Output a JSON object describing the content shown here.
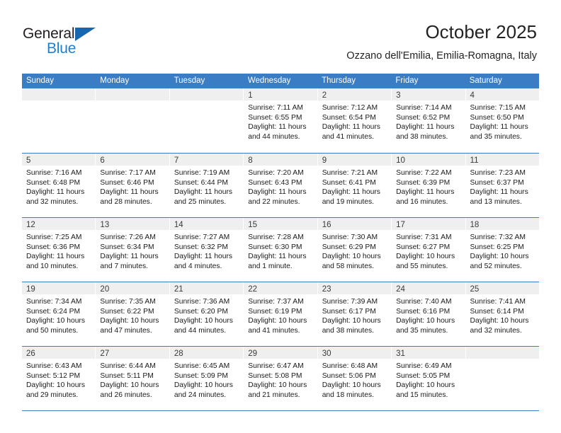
{
  "brand": {
    "name_top": "General",
    "name_bottom": "Blue",
    "color_dark": "#231f20",
    "color_blue": "#1f7fd1"
  },
  "header": {
    "title": "October 2025",
    "subtitle": "Ozzano dell'Emilia, Emilia-Romagna, Italy"
  },
  "theme": {
    "header_bg": "#3b7dc4",
    "daynum_bg": "#efefef",
    "text": "#1a1a1a"
  },
  "calendar": {
    "weekdays": [
      "Sunday",
      "Monday",
      "Tuesday",
      "Wednesday",
      "Thursday",
      "Friday",
      "Saturday"
    ],
    "weeks": [
      [
        {
          "day": "",
          "lines": []
        },
        {
          "day": "",
          "lines": []
        },
        {
          "day": "",
          "lines": []
        },
        {
          "day": "1",
          "lines": [
            "Sunrise: 7:11 AM",
            "Sunset: 6:55 PM",
            "Daylight: 11 hours",
            "and 44 minutes."
          ]
        },
        {
          "day": "2",
          "lines": [
            "Sunrise: 7:12 AM",
            "Sunset: 6:54 PM",
            "Daylight: 11 hours",
            "and 41 minutes."
          ]
        },
        {
          "day": "3",
          "lines": [
            "Sunrise: 7:14 AM",
            "Sunset: 6:52 PM",
            "Daylight: 11 hours",
            "and 38 minutes."
          ]
        },
        {
          "day": "4",
          "lines": [
            "Sunrise: 7:15 AM",
            "Sunset: 6:50 PM",
            "Daylight: 11 hours",
            "and 35 minutes."
          ]
        }
      ],
      [
        {
          "day": "5",
          "lines": [
            "Sunrise: 7:16 AM",
            "Sunset: 6:48 PM",
            "Daylight: 11 hours",
            "and 32 minutes."
          ]
        },
        {
          "day": "6",
          "lines": [
            "Sunrise: 7:17 AM",
            "Sunset: 6:46 PM",
            "Daylight: 11 hours",
            "and 28 minutes."
          ]
        },
        {
          "day": "7",
          "lines": [
            "Sunrise: 7:19 AM",
            "Sunset: 6:44 PM",
            "Daylight: 11 hours",
            "and 25 minutes."
          ]
        },
        {
          "day": "8",
          "lines": [
            "Sunrise: 7:20 AM",
            "Sunset: 6:43 PM",
            "Daylight: 11 hours",
            "and 22 minutes."
          ]
        },
        {
          "day": "9",
          "lines": [
            "Sunrise: 7:21 AM",
            "Sunset: 6:41 PM",
            "Daylight: 11 hours",
            "and 19 minutes."
          ]
        },
        {
          "day": "10",
          "lines": [
            "Sunrise: 7:22 AM",
            "Sunset: 6:39 PM",
            "Daylight: 11 hours",
            "and 16 minutes."
          ]
        },
        {
          "day": "11",
          "lines": [
            "Sunrise: 7:23 AM",
            "Sunset: 6:37 PM",
            "Daylight: 11 hours",
            "and 13 minutes."
          ]
        }
      ],
      [
        {
          "day": "12",
          "lines": [
            "Sunrise: 7:25 AM",
            "Sunset: 6:36 PM",
            "Daylight: 11 hours",
            "and 10 minutes."
          ]
        },
        {
          "day": "13",
          "lines": [
            "Sunrise: 7:26 AM",
            "Sunset: 6:34 PM",
            "Daylight: 11 hours",
            "and 7 minutes."
          ]
        },
        {
          "day": "14",
          "lines": [
            "Sunrise: 7:27 AM",
            "Sunset: 6:32 PM",
            "Daylight: 11 hours",
            "and 4 minutes."
          ]
        },
        {
          "day": "15",
          "lines": [
            "Sunrise: 7:28 AM",
            "Sunset: 6:30 PM",
            "Daylight: 11 hours",
            "and 1 minute."
          ]
        },
        {
          "day": "16",
          "lines": [
            "Sunrise: 7:30 AM",
            "Sunset: 6:29 PM",
            "Daylight: 10 hours",
            "and 58 minutes."
          ]
        },
        {
          "day": "17",
          "lines": [
            "Sunrise: 7:31 AM",
            "Sunset: 6:27 PM",
            "Daylight: 10 hours",
            "and 55 minutes."
          ]
        },
        {
          "day": "18",
          "lines": [
            "Sunrise: 7:32 AM",
            "Sunset: 6:25 PM",
            "Daylight: 10 hours",
            "and 52 minutes."
          ]
        }
      ],
      [
        {
          "day": "19",
          "lines": [
            "Sunrise: 7:34 AM",
            "Sunset: 6:24 PM",
            "Daylight: 10 hours",
            "and 50 minutes."
          ]
        },
        {
          "day": "20",
          "lines": [
            "Sunrise: 7:35 AM",
            "Sunset: 6:22 PM",
            "Daylight: 10 hours",
            "and 47 minutes."
          ]
        },
        {
          "day": "21",
          "lines": [
            "Sunrise: 7:36 AM",
            "Sunset: 6:20 PM",
            "Daylight: 10 hours",
            "and 44 minutes."
          ]
        },
        {
          "day": "22",
          "lines": [
            "Sunrise: 7:37 AM",
            "Sunset: 6:19 PM",
            "Daylight: 10 hours",
            "and 41 minutes."
          ]
        },
        {
          "day": "23",
          "lines": [
            "Sunrise: 7:39 AM",
            "Sunset: 6:17 PM",
            "Daylight: 10 hours",
            "and 38 minutes."
          ]
        },
        {
          "day": "24",
          "lines": [
            "Sunrise: 7:40 AM",
            "Sunset: 6:16 PM",
            "Daylight: 10 hours",
            "and 35 minutes."
          ]
        },
        {
          "day": "25",
          "lines": [
            "Sunrise: 7:41 AM",
            "Sunset: 6:14 PM",
            "Daylight: 10 hours",
            "and 32 minutes."
          ]
        }
      ],
      [
        {
          "day": "26",
          "lines": [
            "Sunrise: 6:43 AM",
            "Sunset: 5:12 PM",
            "Daylight: 10 hours",
            "and 29 minutes."
          ]
        },
        {
          "day": "27",
          "lines": [
            "Sunrise: 6:44 AM",
            "Sunset: 5:11 PM",
            "Daylight: 10 hours",
            "and 26 minutes."
          ]
        },
        {
          "day": "28",
          "lines": [
            "Sunrise: 6:45 AM",
            "Sunset: 5:09 PM",
            "Daylight: 10 hours",
            "and 24 minutes."
          ]
        },
        {
          "day": "29",
          "lines": [
            "Sunrise: 6:47 AM",
            "Sunset: 5:08 PM",
            "Daylight: 10 hours",
            "and 21 minutes."
          ]
        },
        {
          "day": "30",
          "lines": [
            "Sunrise: 6:48 AM",
            "Sunset: 5:06 PM",
            "Daylight: 10 hours",
            "and 18 minutes."
          ]
        },
        {
          "day": "31",
          "lines": [
            "Sunrise: 6:49 AM",
            "Sunset: 5:05 PM",
            "Daylight: 10 hours",
            "and 15 minutes."
          ]
        },
        {
          "day": "",
          "lines": []
        }
      ]
    ]
  }
}
